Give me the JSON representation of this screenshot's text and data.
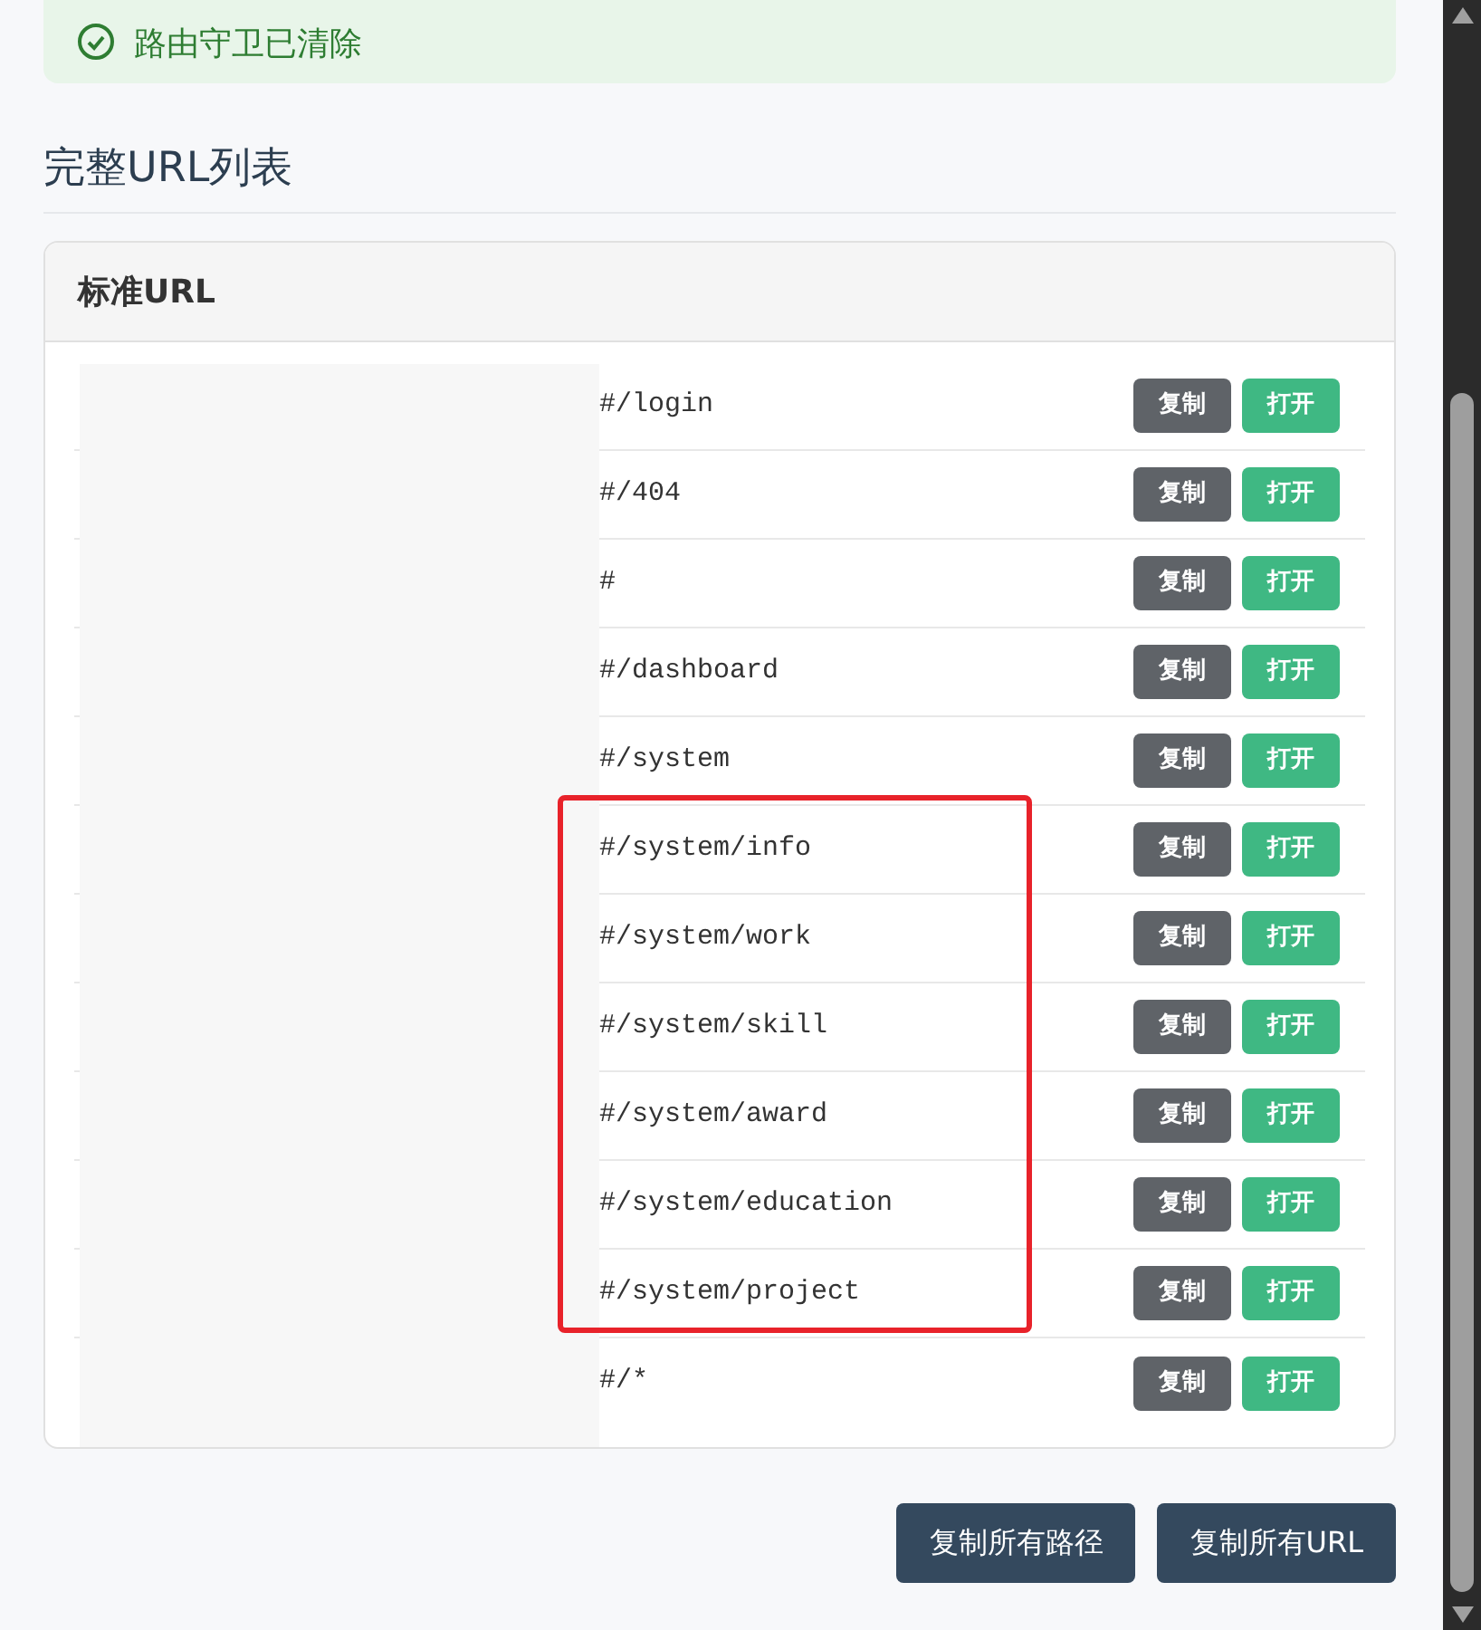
{
  "alert": {
    "text": "路由守卫已清除"
  },
  "heading": "完整URL列表",
  "card": {
    "title": "标准URL",
    "rows": [
      {
        "path": "#/login",
        "copy": "复制",
        "open": "打开",
        "highlighted": false
      },
      {
        "path": "#/404",
        "copy": "复制",
        "open": "打开",
        "highlighted": false
      },
      {
        "path": "#",
        "copy": "复制",
        "open": "打开",
        "highlighted": false
      },
      {
        "path": "#/dashboard",
        "copy": "复制",
        "open": "打开",
        "highlighted": false
      },
      {
        "path": "#/system",
        "copy": "复制",
        "open": "打开",
        "highlighted": false
      },
      {
        "path": "#/system/info",
        "copy": "复制",
        "open": "打开",
        "highlighted": true
      },
      {
        "path": "#/system/work",
        "copy": "复制",
        "open": "打开",
        "highlighted": true
      },
      {
        "path": "#/system/skill",
        "copy": "复制",
        "open": "打开",
        "highlighted": true
      },
      {
        "path": "#/system/award",
        "copy": "复制",
        "open": "打开",
        "highlighted": true
      },
      {
        "path": "#/system/education",
        "copy": "复制",
        "open": "打开",
        "highlighted": true
      },
      {
        "path": "#/system/project",
        "copy": "复制",
        "open": "打开",
        "highlighted": true
      },
      {
        "path": "#/*",
        "copy": "复制",
        "open": "打开",
        "highlighted": false
      }
    ]
  },
  "buttons": [
    "复制所有路径",
    "复制所有URL"
  ]
}
